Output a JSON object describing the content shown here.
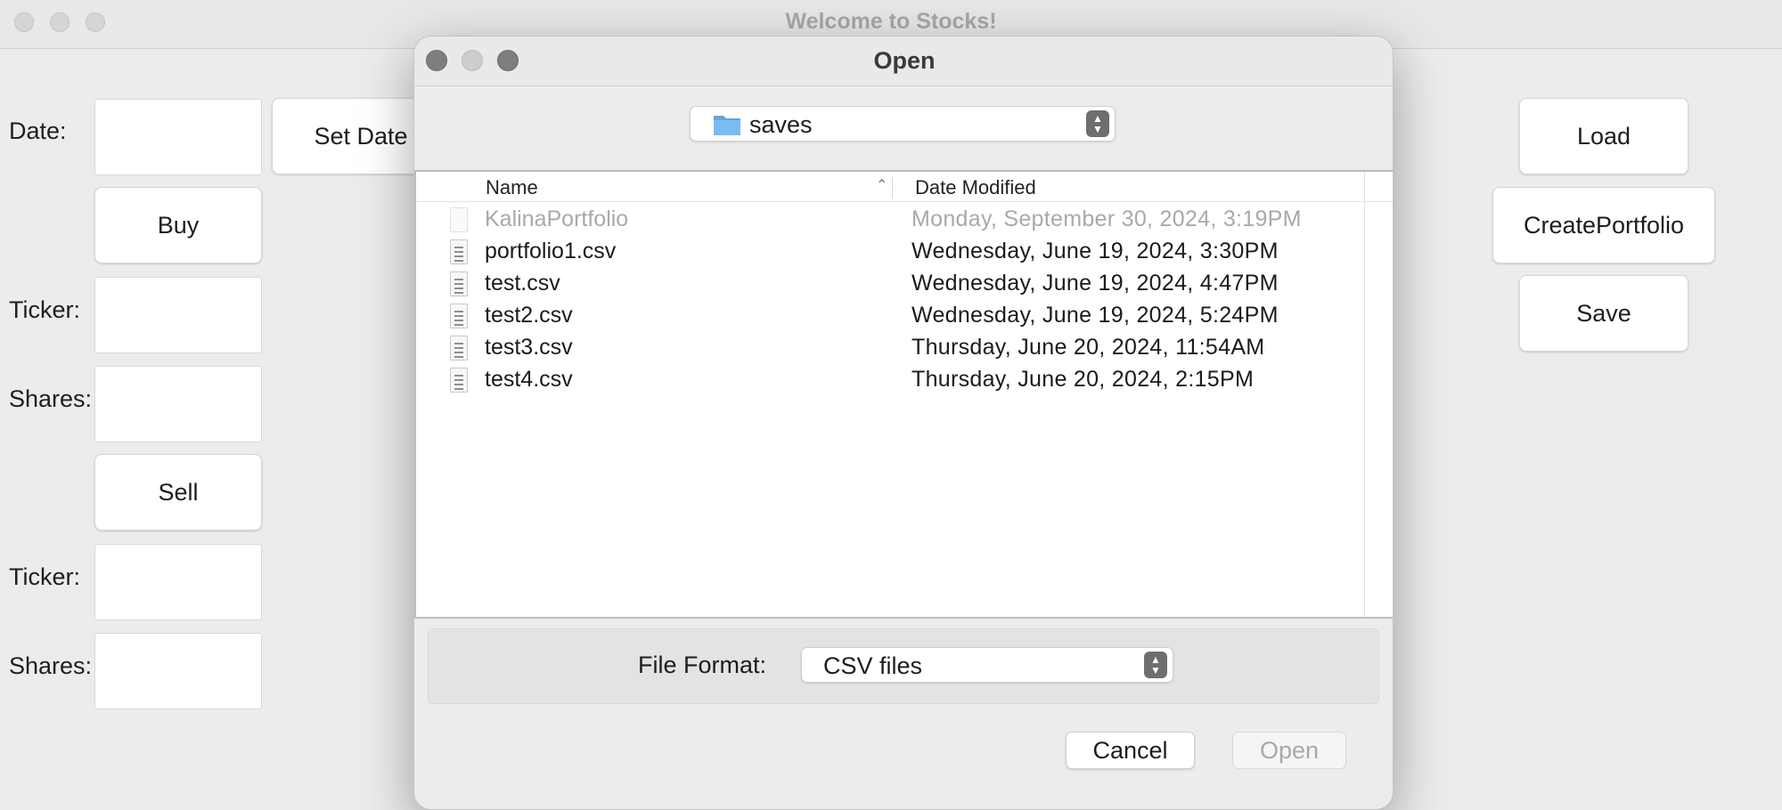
{
  "main_window": {
    "title": "Welcome to Stocks!",
    "date_label": "Date:",
    "set_date_button": "Set Date",
    "buy_button": "Buy",
    "buy_ticker_label": "Ticker:",
    "buy_shares_label": "Shares:",
    "sell_button": "Sell",
    "sell_ticker_label": "Ticker:",
    "sell_shares_label": "Shares:",
    "load_button": "Load",
    "create_portfolio_button": "CreatePortfolio",
    "save_button": "Save"
  },
  "dialog": {
    "title": "Open",
    "folder": "saves",
    "columns": {
      "name": "Name",
      "date_modified": "Date Modified"
    },
    "files": [
      {
        "name": "KalinaPortfolio",
        "date": "Monday, September 30, 2024, 3:19PM",
        "enabled": false
      },
      {
        "name": "portfolio1.csv",
        "date": "Wednesday, June 19, 2024, 3:30PM",
        "enabled": true
      },
      {
        "name": "test.csv",
        "date": "Wednesday, June 19, 2024, 4:47PM",
        "enabled": true
      },
      {
        "name": "test2.csv",
        "date": "Wednesday, June 19, 2024, 5:24PM",
        "enabled": true
      },
      {
        "name": "test3.csv",
        "date": "Thursday, June 20, 2024, 11:54AM",
        "enabled": true
      },
      {
        "name": "test4.csv",
        "date": "Thursday, June 20, 2024, 2:15PM",
        "enabled": true
      }
    ],
    "file_format_label": "File Format:",
    "file_format_value": "CSV files",
    "cancel_button": "Cancel",
    "open_button": "Open"
  },
  "colors": {
    "close": "#ff5f57",
    "minimize": "#febc2e",
    "zoom": "#28c840",
    "dialog_traffic": "#8a8a8a",
    "folder_blue": "#5aa8e6"
  }
}
